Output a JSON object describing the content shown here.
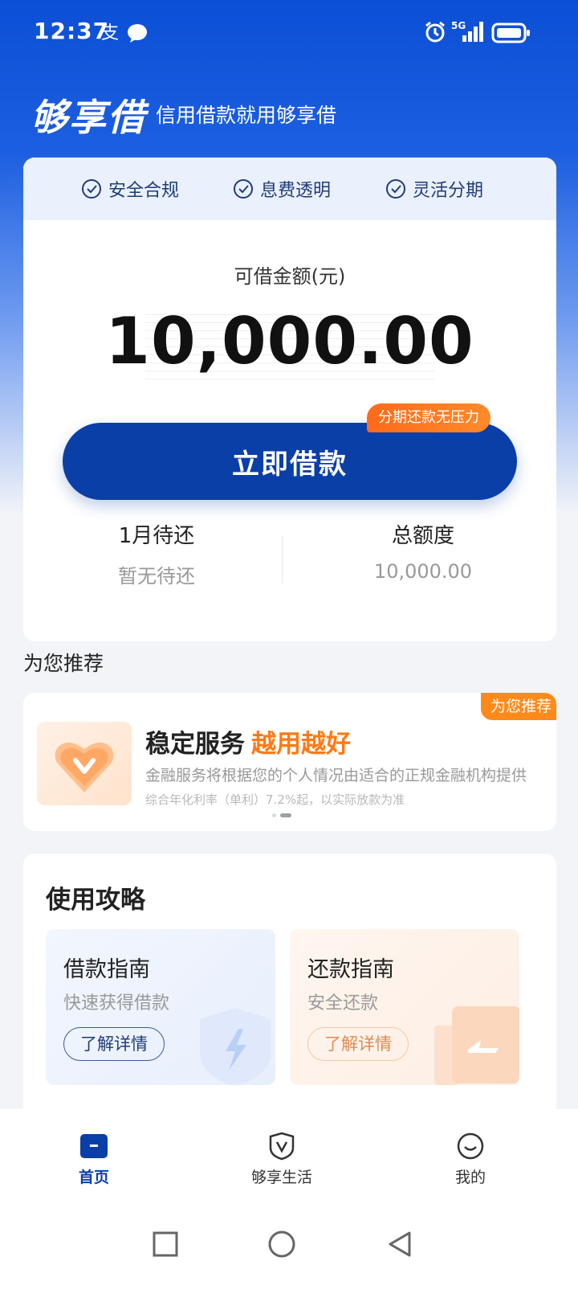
{
  "status_bar": {
    "time": "12:37",
    "signal_label": "5G"
  },
  "brand": {
    "logo": "够享借",
    "slogan": "信用借款就用够享借"
  },
  "features": [
    "安全合规",
    "息费透明",
    "灵活分期"
  ],
  "loan": {
    "label": "可借金额(元)",
    "amount": "10,000.00",
    "button": "立即借款",
    "promo_tag": "分期还款无压力"
  },
  "stats": [
    {
      "title": "1月待还",
      "value": "暂无待还"
    },
    {
      "title": "总额度",
      "value": "10,000.00"
    }
  ],
  "recommend": {
    "heading": "为您推荐",
    "ribbon": "为您推荐",
    "title": "稳定服务",
    "title_highlight": "越用越好",
    "desc": "金融服务将根据您的个人情况由适合的正规金融机构提供",
    "note": "综合年化利率（单利）7.2%起，以实际放款为准",
    "carousel": {
      "pages": 2,
      "active": 2
    }
  },
  "guide": {
    "heading": "使用攻略",
    "tiles": [
      {
        "title": "借款指南",
        "sub": "快速获得借款",
        "button": "了解详情"
      },
      {
        "title": "还款指南",
        "sub": "安全还款",
        "button": "了解详情"
      }
    ]
  },
  "nav": {
    "active": "首页",
    "items": [
      {
        "label": "首页",
        "icon": "home-icon"
      },
      {
        "label": "够享生活",
        "icon": "shield-v-icon"
      },
      {
        "label": "我的",
        "icon": "smiley-icon"
      }
    ]
  },
  "colors": {
    "primary": "#0a3fa8",
    "accent": "#ff7a14",
    "nav_active": "#0a3fa8",
    "nav_inactive": "#333333"
  }
}
